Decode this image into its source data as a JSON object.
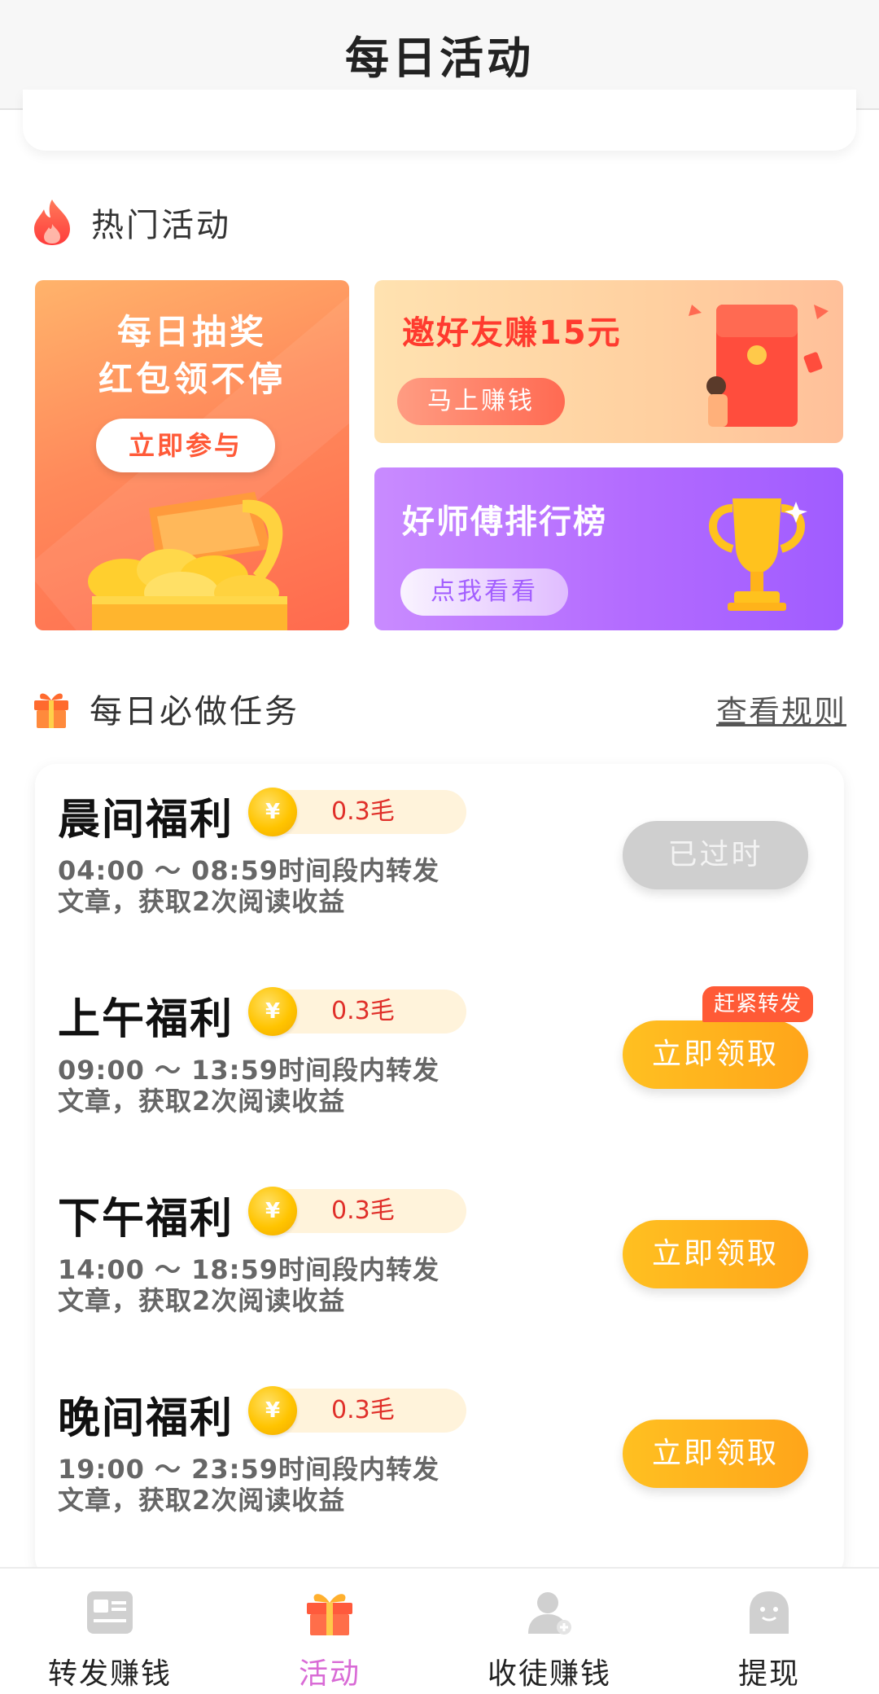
{
  "header": {
    "title": "每日活动"
  },
  "hot_section": {
    "title": "热门活动"
  },
  "promos": {
    "left": {
      "line1": "每日抽奖",
      "line2": "红包领不停",
      "button": "立即参与"
    },
    "right_top": {
      "title": "邀好友赚15元",
      "button": "马上赚钱"
    },
    "right_bottom": {
      "title": "好师傅排行榜",
      "button": "点我看看"
    }
  },
  "tasks_section": {
    "title": "每日必做任务",
    "rules_link": "查看规则"
  },
  "tasks": [
    {
      "title": "晨间福利",
      "reward": "0.3毛",
      "line1": "04:00 ～ 08:59时间段内转发",
      "line2": "文章，获取2次阅读收益",
      "button": "已过时",
      "state": "expired"
    },
    {
      "title": "上午福利",
      "reward": "0.3毛",
      "line1": "09:00 ～ 13:59时间段内转发",
      "line2": "文章，获取2次阅读收益",
      "button": "立即领取",
      "tag": "赶紧转发",
      "state": "active"
    },
    {
      "title": "下午福利",
      "reward": "0.3毛",
      "line1": "14:00 ～ 18:59时间段内转发",
      "line2": "文章，获取2次阅读收益",
      "button": "立即领取",
      "state": "active"
    },
    {
      "title": "晚间福利",
      "reward": "0.3毛",
      "line1": "19:00 ～ 23:59时间段内转发",
      "line2": "文章，获取2次阅读收益",
      "button": "立即领取",
      "state": "active"
    }
  ],
  "coin_symbol": "¥",
  "bottom_nav": [
    {
      "label": "转发赚钱",
      "icon": "article-icon",
      "active": false
    },
    {
      "label": "活动",
      "icon": "gift-icon",
      "active": true
    },
    {
      "label": "收徒赚钱",
      "icon": "add-user-icon",
      "active": false
    },
    {
      "label": "提现",
      "icon": "ghost-face-icon",
      "active": false
    }
  ],
  "colors": {
    "accent_orange": "#ffb01e",
    "active_nav": "#d96bd6",
    "reward_red": "#e0302a",
    "hot_tag": "#ff5a36"
  }
}
